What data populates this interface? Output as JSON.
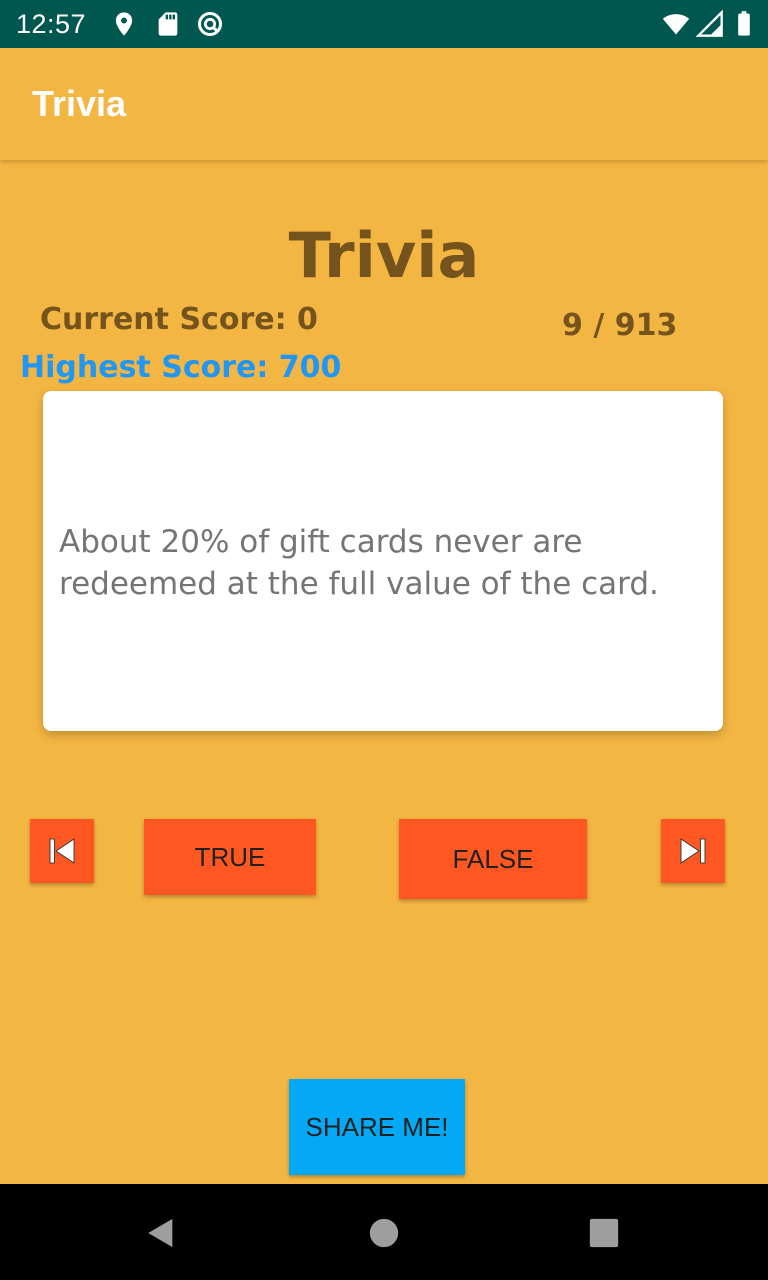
{
  "status_bar": {
    "time": "12:57",
    "icons": [
      "location-icon",
      "sd-card-icon",
      "vpn-icon",
      "wifi-icon",
      "signal-icon",
      "battery-icon"
    ],
    "background": "#00574F"
  },
  "app_bar": {
    "title": "Trivia"
  },
  "game": {
    "title": "Trivia",
    "current_score": "Current Score: 0",
    "progress": "9 / 913",
    "highest_score": "Highest Score: 700",
    "question": "About 20% of gift cards never are redeemed at the full value of the card."
  },
  "controls": {
    "true_label": "TRUE",
    "false_label": "FALSE",
    "share_label": "SHARE ME!",
    "prev_icon": "skip-previous-icon",
    "next_icon": "skip-next-icon"
  },
  "nav_bar": {
    "icons": [
      "back-icon",
      "home-icon",
      "recents-icon"
    ]
  },
  "colors": {
    "background": "#F4B642",
    "title_brown": "#74531C",
    "highest_score_blue": "#2196F3",
    "button_orange": "#FF5722",
    "share_blue": "#03A9F4"
  }
}
